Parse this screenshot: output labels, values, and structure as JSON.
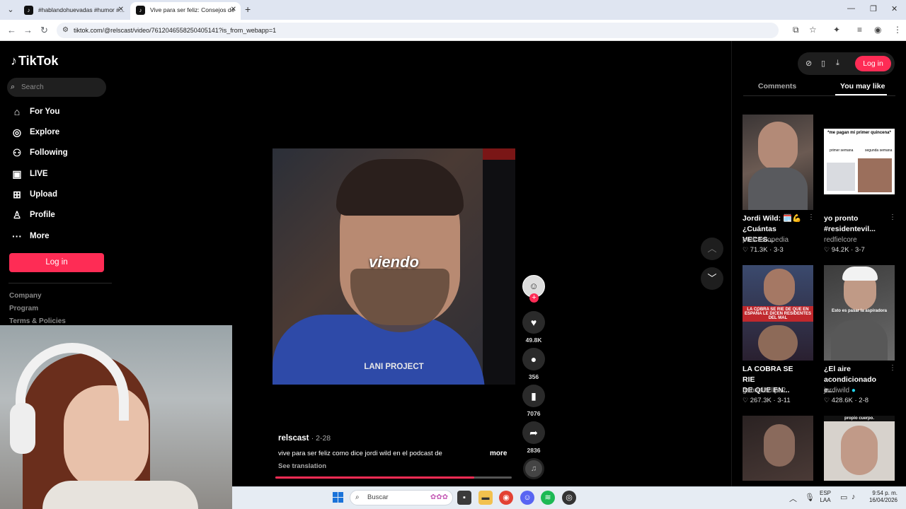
{
  "browser": {
    "tabs": [
      {
        "label": "#hablandohuevadas #humor #..."
      },
      {
        "label": "Vive para ser feliz: Consejos de"
      }
    ],
    "url": "tiktok.com/@relscast/video/7612046558250405141?is_from_webapp=1"
  },
  "sidebar": {
    "logo": "TikTok",
    "search_placeholder": "Search",
    "nav": [
      {
        "label": "For You",
        "icon": "home-icon"
      },
      {
        "label": "Explore",
        "icon": "compass-icon"
      },
      {
        "label": "Following",
        "icon": "following-icon"
      },
      {
        "label": "LIVE",
        "icon": "live-icon"
      },
      {
        "label": "Upload",
        "icon": "upload-icon"
      },
      {
        "label": "Profile",
        "icon": "profile-icon"
      },
      {
        "label": "More",
        "icon": "more-icon"
      }
    ],
    "login_label": "Log in",
    "footer_links": [
      "Company",
      "Program",
      "Terms & Policies"
    ]
  },
  "video": {
    "caption": "viendo",
    "watermark": "LANI PROJECT",
    "author": "relscast",
    "date": "· 2-28",
    "description": "vive para ser feliz como dice jordi wild en el podcast de",
    "more_label": "more",
    "translate_label": "See translation",
    "progress": 0.84
  },
  "actions": {
    "likes": "49.8K",
    "comments": "356",
    "saves": "7076",
    "shares": "2836"
  },
  "right_panel": {
    "login_label": "Log in",
    "tabs": [
      {
        "label": "Comments",
        "active": false
      },
      {
        "label": "You may like",
        "active": true
      }
    ],
    "videos": [
      {
        "title_line1": "Jordi Wild: 🗓️💪",
        "title_line2": "¿Cuántas VECES...",
        "user": "podcastopedia",
        "likes": "71.3K",
        "date": "3-3"
      },
      {
        "title_line1": "yo pronto",
        "title_line2": "#residentevil...",
        "user": "redfielcore",
        "likes": "94.2K",
        "date": "3-7",
        "thumb_text": "*me pagan mi primer quincena*",
        "thumb_sub1": "primer semana",
        "thumb_sub2": "segunda semana"
      },
      {
        "title_line1": "LA COBRA SE RIE",
        "title_line2": "DE QUE EN...",
        "user": "gabrielaclips2",
        "likes": "267.3K",
        "date": "3-11",
        "thumb_text": "LA COBRA SE RIE DE QUE EN ESPAÑA LE DICEN RESIDENTES DEL MAL"
      },
      {
        "title_line1": "¿El aire",
        "title_line2": "acondicionado e...",
        "user": "jordiwild",
        "likes": "428.6K",
        "date": "2-8",
        "thumb_text": "Esto es pasar la aspiradora"
      },
      {
        "thumb_text": ""
      },
      {
        "thumb_text": "propio cuerpo."
      }
    ]
  },
  "taskbar": {
    "search_placeholder": "Buscar",
    "lang_line1": "ESP",
    "lang_line2": "LAA",
    "time": "9:54 p. m.",
    "date": "16/04/2026"
  },
  "colors": {
    "accent": "#fe2c55",
    "background": "#000000"
  }
}
